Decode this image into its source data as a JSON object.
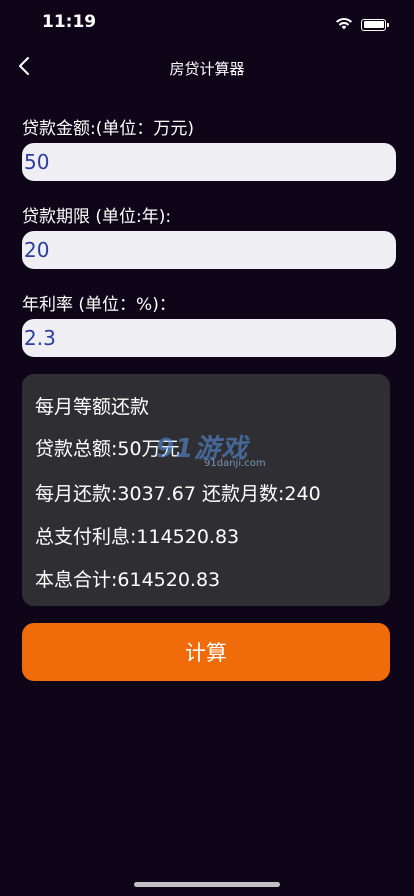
{
  "status": {
    "time": "11:19"
  },
  "nav": {
    "title": "房贷计算器"
  },
  "form": {
    "amount_label": "贷款金额:(单位：万元)",
    "amount_value": "50",
    "term_label": "贷款期限 (单位:年):",
    "term_value": "20",
    "rate_label": "年利率 (单位：%)：",
    "rate_value": "2.3"
  },
  "result": {
    "method": "每月等额还款",
    "total_loan": "贷款总额:50万元",
    "monthly": "每月还款:3037.67  还款月数:240",
    "total_interest": "总支付利息:114520.83",
    "total_sum": "本息合计:614520.83"
  },
  "watermark": {
    "main": "91游戏",
    "sub": "91danji.com"
  },
  "button": {
    "calculate": "计算"
  },
  "colors": {
    "background": "#0e0618",
    "accent": "#f06c0a",
    "card": "#2f2f33",
    "input": "#eeeef3",
    "input_text": "#2b3ea0"
  }
}
